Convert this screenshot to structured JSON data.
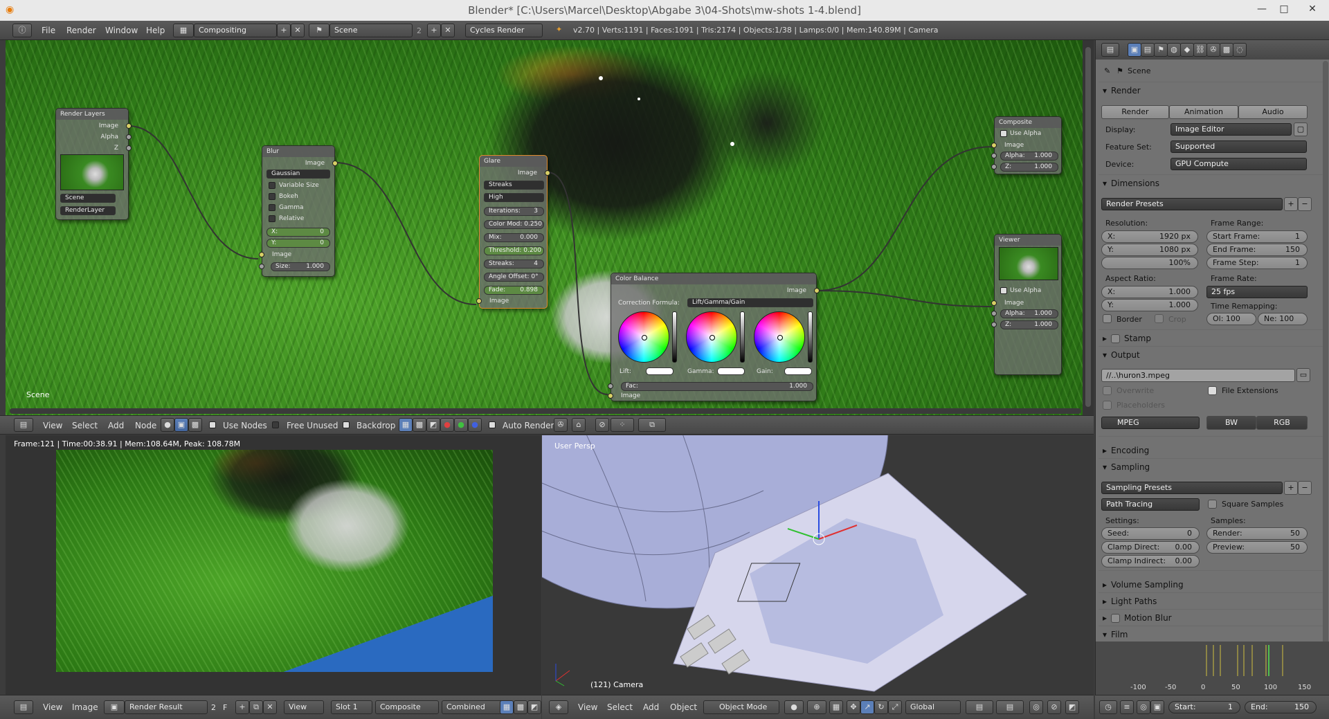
{
  "window": {
    "title": "Blender* [C:\\Users\\Marcel\\Desktop\\Abgabe 3\\04-Shots\\mw-shots 1-4.blend]",
    "minimize": "—",
    "maximize": "□",
    "close": "✕"
  },
  "info_header": {
    "menus": [
      "File",
      "Render",
      "Window",
      "Help"
    ],
    "screen_layout": "Compositing",
    "scene": "Scene",
    "scene_users": "2",
    "engine": "Cycles Render",
    "stats": "v2.70 | Verts:1191 | Faces:1091 | Tris:2174 | Objects:1/38 | Lamps:0/0 | Mem:140.89M | Camera"
  },
  "node_editor": {
    "scene_label": "Scene",
    "render_layers": {
      "title": "Render Layers",
      "outputs": [
        "Image",
        "Alpha",
        "Z"
      ],
      "scene": "Scene",
      "layer": "RenderLayer"
    },
    "blur": {
      "title": "Blur",
      "output": "Image",
      "type": "Gaussian",
      "options": [
        "Variable Size",
        "Bokeh",
        "Gamma",
        "Relative"
      ],
      "x": "0",
      "y": "0",
      "input_image": "Image",
      "size_label": "Size:",
      "size": "1.000",
      "x_label": "X:",
      "y_label": "Y:"
    },
    "glare": {
      "title": "Glare",
      "output": "Image",
      "type": "Streaks",
      "quality": "High",
      "iterations_label": "Iterations:",
      "iterations": "3",
      "color_mod": "Color Mod: 0.250",
      "mix_label": "Mix:",
      "mix": "0.000",
      "threshold": "Threshold: 0.200",
      "streaks_label": "Streaks:",
      "streaks": "4",
      "angle_offset": "Angle Offset: 0°",
      "fade_label": "Fade:",
      "fade": "0.898",
      "input_image": "Image"
    },
    "color_balance": {
      "title": "Color Balance",
      "output": "Image",
      "formula_label": "Correction Formula:",
      "formula": "Lift/Gamma/Gain",
      "lift": "Lift:",
      "gamma": "Gamma:",
      "gain": "Gain:",
      "fac_label": "Fac:",
      "fac": "1.000",
      "input_image": "Image"
    },
    "composite": {
      "title": "Composite",
      "use_alpha": "Use Alpha",
      "input_image": "Image",
      "alpha_label": "Alpha:",
      "alpha": "1.000",
      "z_label": "Z:",
      "z": "1.000"
    },
    "viewer": {
      "title": "Viewer",
      "use_alpha": "Use Alpha",
      "input_image": "Image",
      "alpha_label": "Alpha:",
      "alpha": "1.000",
      "z_label": "Z:",
      "z": "1.000"
    }
  },
  "node_header": {
    "menus": [
      "View",
      "Select",
      "Add",
      "Node"
    ],
    "use_nodes": "Use Nodes",
    "free_unused": "Free Unused",
    "backdrop": "Backdrop",
    "auto_render": "Auto Render"
  },
  "image_editor": {
    "info": "Frame:121 | Time:00:38.91 | Mem:108.64M, Peak: 108.78M",
    "menus": [
      "View",
      "Image"
    ],
    "image": "Render Result",
    "users": "2",
    "fake": "F",
    "view": "View",
    "slot": "Slot 1",
    "layer": "Composite",
    "pass": "Combined"
  },
  "view3d": {
    "persp": "User Persp",
    "camera": "(121) Camera",
    "menus": [
      "View",
      "Select",
      "Add",
      "Object"
    ],
    "mode": "Object Mode",
    "orientation": "Global"
  },
  "properties": {
    "breadcrumb": "Scene",
    "render_section": "Render",
    "render_btn": "Render",
    "animation_btn": "Animation",
    "audio_btn": "Audio",
    "display_label": "Display:",
    "display": "Image Editor",
    "feature_label": "Feature Set:",
    "feature": "Supported",
    "device_label": "Device:",
    "device": "GPU Compute",
    "dimensions": "Dimensions",
    "render_presets": "Render Presets",
    "resolution_label": "Resolution:",
    "res_x_label": "X:",
    "res_x": "1920 px",
    "res_y_label": "Y:",
    "res_y": "1080 px",
    "res_pct": "100%",
    "frame_range_label": "Frame Range:",
    "start_label": "Start Frame:",
    "start": "1",
    "end_label": "End Frame:",
    "end": "150",
    "step_label": "Frame Step:",
    "step": "1",
    "aspect_label": "Aspect Ratio:",
    "asp_x_label": "X:",
    "asp_x": "1.000",
    "asp_y_label": "Y:",
    "asp_y": "1.000",
    "frame_rate_label": "Frame Rate:",
    "fps": "25 fps",
    "time_remap_label": "Time Remapping:",
    "old": "Ol: 100",
    "new": "Ne: 100",
    "border": "Border",
    "crop": "Crop",
    "stamp": "Stamp",
    "output": "Output",
    "output_path": "//..\\huron3.mpeg",
    "overwrite": "Overwrite",
    "file_ext": "File Extensions",
    "placeholders": "Placeholders",
    "format": "MPEG",
    "bw": "BW",
    "rgb": "RGB",
    "encoding": "Encoding",
    "sampling": "Sampling",
    "sampling_presets": "Sampling Presets",
    "integrator": "Path Tracing",
    "square_samples": "Square Samples",
    "settings_label": "Settings:",
    "seed_label": "Seed:",
    "seed": "0",
    "clamp_direct_label": "Clamp Direct:",
    "clamp_direct": "0.00",
    "clamp_indirect_label": "Clamp Indirect:",
    "clamp_indirect": "0.00",
    "samples_label": "Samples:",
    "render_samples_label": "Render:",
    "render_samples": "50",
    "preview_samples_label": "Preview:",
    "preview_samples": "50",
    "volume_sampling": "Volume Sampling",
    "light_paths": "Light Paths",
    "motion_blur": "Motion Blur",
    "film": "Film"
  },
  "timeline": {
    "ticks": [
      "-100",
      "-50",
      "0",
      "50",
      "100",
      "150"
    ],
    "start_label": "Start:",
    "start": "1",
    "end_label": "End:",
    "end": "150"
  }
}
